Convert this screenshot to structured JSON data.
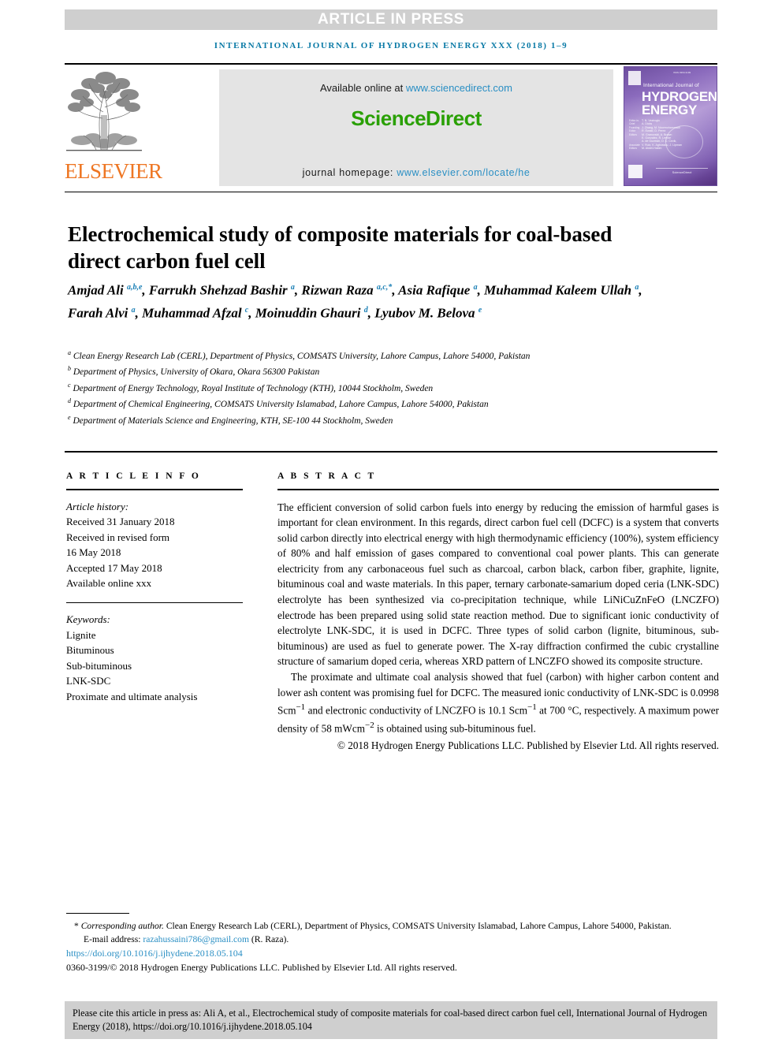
{
  "banner": {
    "article_in_press": "ARTICLE IN PRESS",
    "journal_running_head": "International Journal of Hydrogen Energy xxx (2018) 1–9"
  },
  "masthead": {
    "elsevier_wordmark": "ELSEVIER",
    "available_online_prefix": "Available online at ",
    "sciencedirect_url": "www.sciencedirect.com",
    "sciencedirect_wordmark": "ScienceDirect",
    "homepage_prefix": "journal homepage: ",
    "homepage_url": "www.elsevier.com/locate/he",
    "cover": {
      "line_small": "International Journal of",
      "line_big_1": "HYDROGEN",
      "line_big_2": "ENERGY",
      "editor_labels": "Editor-in-Chief\nFounding Editor\nEditors",
      "publisher": "ScienceDirect"
    },
    "colors": {
      "journal_head_blue": "#0a7aa6",
      "link_blue": "#2a8fc4",
      "sciencedirect_green": "#2aa005",
      "elsevier_orange": "#ee7623",
      "banner_gray": "#cfcfcf",
      "sd_box_gray": "#e4e4e4"
    }
  },
  "article": {
    "title": "Electrochemical study of composite materials for coal-based direct carbon fuel cell",
    "authors_html": "Amjad Ali <sup>a,b,e</sup>, Farrukh Shehzad Bashir <sup>a</sup>, Rizwan Raza <sup>a,c,*</sup>, Asia Rafique <sup>a</sup>, Muhammad Kaleem Ullah <sup>a</sup>, Farah Alvi <sup>a</sup>, Muhammad Afzal <sup>c</sup>, Moinuddin Ghauri <sup>d</sup>, Lyubov M. Belova <sup>e</sup>",
    "affiliations": [
      {
        "marker": "a",
        "text": "Clean Energy Research Lab (CERL), Department of Physics, COMSATS University, Lahore Campus, Lahore 54000, Pakistan"
      },
      {
        "marker": "b",
        "text": "Department of Physics, University of Okara, Okara 56300 Pakistan"
      },
      {
        "marker": "c",
        "text": "Department of Energy Technology, Royal Institute of Technology (KTH), 10044 Stockholm, Sweden"
      },
      {
        "marker": "d",
        "text": "Department of Chemical Engineering, COMSATS University Islamabad, Lahore Campus, Lahore 54000, Pakistan"
      },
      {
        "marker": "e",
        "text": "Department of Materials Science and Engineering, KTH, SE-100 44 Stockholm, Sweden"
      }
    ]
  },
  "article_info": {
    "heading": "A R T I C L E   I N F O",
    "history_label": "Article history:",
    "history": [
      "Received 31 January 2018",
      "Received in revised form",
      "16 May 2018",
      "Accepted 17 May 2018",
      "Available online xxx"
    ],
    "keywords_label": "Keywords:",
    "keywords": [
      "Lignite",
      "Bituminous",
      "Sub-bituminous",
      "LNK-SDC",
      "Proximate and ultimate analysis"
    ]
  },
  "abstract": {
    "heading": "A B S T R A C T",
    "paragraph_1": "The efficient conversion of solid carbon fuels into energy by reducing the emission of harmful gases is important for clean environment. In this regards, direct carbon fuel cell (DCFC) is a system that converts solid carbon directly into electrical energy with high thermodynamic efficiency (100%), system efficiency of 80% and half emission of gases compared to conventional coal power plants. This can generate electricity from any carbonaceous fuel such as charcoal, carbon black, carbon fiber, graphite, lignite, bituminous coal and waste materials. In this paper, ternary carbonate-samarium doped ceria (LNK-SDC) electrolyte has been synthesized via co-precipitation technique, while LiNiCuZnFeO (LNCZFO) electrode has been prepared using solid state reaction method. Due to significant ionic conductivity of electrolyte LNK-SDC, it is used in DCFC. Three types of solid carbon (lignite, bituminous, sub-bituminous) are used as fuel to generate power. The X-ray diffraction confirmed the cubic crystalline structure of samarium doped ceria, whereas XRD pattern of LNCZFO showed its composite structure.",
    "paragraph_2_html": "The proximate and ultimate coal analysis showed that fuel (carbon) with higher carbon content and lower ash content was promising fuel for DCFC. The measured ionic conductivity of LNK-SDC is 0.0998 Scm<sup>&minus;1</sup> and electronic conductivity of LNCZFO is 10.1 Scm<sup>&minus;1</sup> at 700 &deg;C, respectively. A maximum power density of 58 mWcm<sup>&minus;2</sup> is obtained using sub-bituminous fuel.",
    "copyright": "© 2018 Hydrogen Energy Publications LLC. Published by Elsevier Ltd. All rights reserved."
  },
  "footnotes": {
    "corresponding_author_label": "Corresponding author.",
    "corresponding_author_address": "Clean Energy Research Lab (CERL), Department of Physics, COMSATS University Islamabad, Lahore Campus, Lahore 54000, Pakistan.",
    "email_label": "E-mail address:",
    "email": "razahussaini786@gmail.com",
    "email_owner": "(R. Raza).",
    "doi": "https://doi.org/10.1016/j.ijhydene.2018.05.104",
    "issn_line": "0360-3199/© 2018 Hydrogen Energy Publications LLC. Published by Elsevier Ltd. All rights reserved."
  },
  "cite_box": {
    "text": "Please cite this article in press as: Ali A, et al., Electrochemical study of composite materials for coal-based direct carbon fuel cell, International Journal of Hydrogen Energy (2018), https://doi.org/10.1016/j.ijhydene.2018.05.104"
  }
}
